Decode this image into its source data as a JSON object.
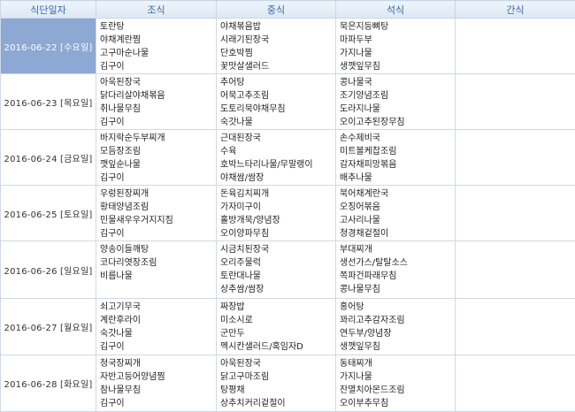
{
  "headers": [
    "식단일자",
    "조식",
    "중식",
    "석식",
    "간식"
  ],
  "rows": [
    {
      "date": "2016-06-22 [수요일]",
      "breakfast": [
        "토란탕",
        "야채계란찜",
        "고구마순나물",
        "김구이"
      ],
      "lunch": [
        "야채볶음밥",
        "시래기된장국",
        "단호박찜",
        "꽃맛살샐러드"
      ],
      "dinner": [
        "묵은지등뼈탕",
        "마파두부",
        "가지나물",
        "생깻잎무침"
      ],
      "snack": []
    },
    {
      "date": "2016-06-23 [목요일]",
      "breakfast": [
        "아욱된장국",
        "닭다리살야채볶음",
        "취나물무침",
        "김구이"
      ],
      "lunch": [
        "추어탕",
        "어묵고추조림",
        "도토리묵야채무침",
        "숙갓나물"
      ],
      "dinner": [
        "콩나물국",
        "조기양념조림",
        "도라지나물",
        "오이고추된장무침"
      ],
      "snack": []
    },
    {
      "date": "2016-06-24 [금요일]",
      "breakfast": [
        "바지락순두부찌개",
        "모듬장조림",
        "깻잎순나물",
        "김구이"
      ],
      "lunch": [
        "근대된장국",
        "수육",
        "호박느타리나물/무말랭이",
        "야채쌈/쌈장"
      ],
      "dinner": [
        "손수제비국",
        "미트볼케찹조림",
        "감자채피망볶음",
        "배추나물"
      ],
      "snack": []
    },
    {
      "date": "2016-06-25 [토요일]",
      "breakfast": [
        "우렁된장찌개",
        "황태양념조림",
        "민물새우우거지지짐",
        "김구이"
      ],
      "lunch": [
        "돈육김치찌개",
        "가자미구이",
        "홀방개묵/양념장",
        "오이양파무침"
      ],
      "dinner": [
        "북어채계란국",
        "오징어볶음",
        "고사리나물",
        "청경채겉절이"
      ],
      "snack": []
    },
    {
      "date": "2016-06-26 [일요일]",
      "breakfast": [
        "양송이들깨탕",
        "코다리엿장조림",
        "비름나물"
      ],
      "lunch": [
        "시금치된장국",
        "오리주물럭",
        "토란대나물",
        "상추쌈/쌈장"
      ],
      "dinner": [
        "부대찌개",
        "생선가스/탈탈소스",
        "쪽파건파래무침",
        "콩나물무침"
      ],
      "snack": []
    },
    {
      "date": "2016-06-27 [월요일]",
      "breakfast": [
        "쇠고기무국",
        "계란후라이",
        "숙갓나물",
        "김구이"
      ],
      "lunch": [
        "짜장밥",
        "미소시로",
        "군만두",
        "멕시칸샐러드/혹임자D"
      ],
      "dinner": [
        "홍어탕",
        "꽈리고추감자조림",
        "연두부/양념장",
        "생깻잎무침"
      ],
      "snack": []
    },
    {
      "date": "2016-06-28 [화요일]",
      "breakfast": [
        "청국장찌개",
        "자반고등어양념찜",
        "참나물무침",
        "김구이"
      ],
      "lunch": [
        "아욱된장국",
        "닭고구마조림",
        "탕평채",
        "상추치커리겉절이"
      ],
      "dinner": [
        "동태찌개",
        "가지나물",
        "잔멸치아몬드조림",
        "오이부추무침"
      ],
      "snack": []
    }
  ],
  "colors": {
    "header_text": "#3a6aa8",
    "selected_bg": "#8ea8d4",
    "border": "#cfd9e4"
  }
}
